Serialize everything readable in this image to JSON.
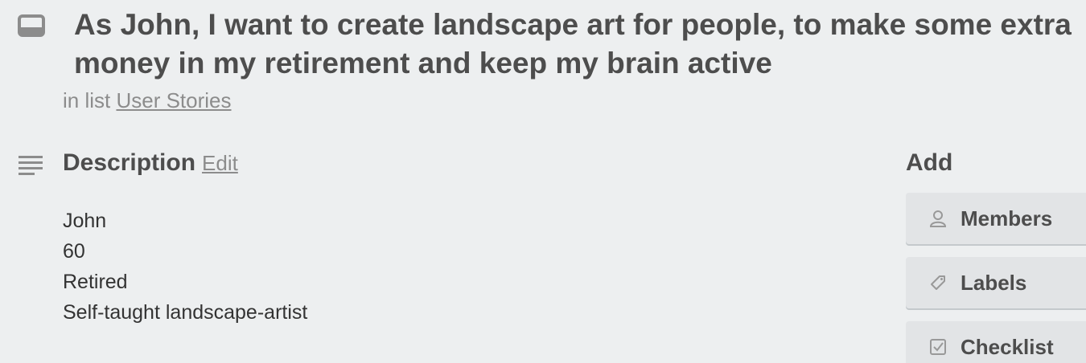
{
  "card": {
    "title": "As John, I want to create landscape art for people, to make some extra money in my retirement and keep my brain active",
    "in_list_prefix": "in list ",
    "list_name": "User Stories"
  },
  "description": {
    "heading": "Description",
    "edit_label": "Edit",
    "lines": [
      "John",
      "60",
      "Retired",
      "Self-taught landscape-artist"
    ]
  },
  "add": {
    "heading": "Add",
    "buttons": [
      {
        "label": "Members",
        "icon": "person-icon"
      },
      {
        "label": "Labels",
        "icon": "tag-icon"
      },
      {
        "label": "Checklist",
        "icon": "checkbox-icon"
      }
    ]
  },
  "colors": {
    "background": "#edeff0",
    "button_bg": "#e2e4e6",
    "text_dark": "#4d4d4d",
    "text_muted": "#8c8c8c"
  }
}
